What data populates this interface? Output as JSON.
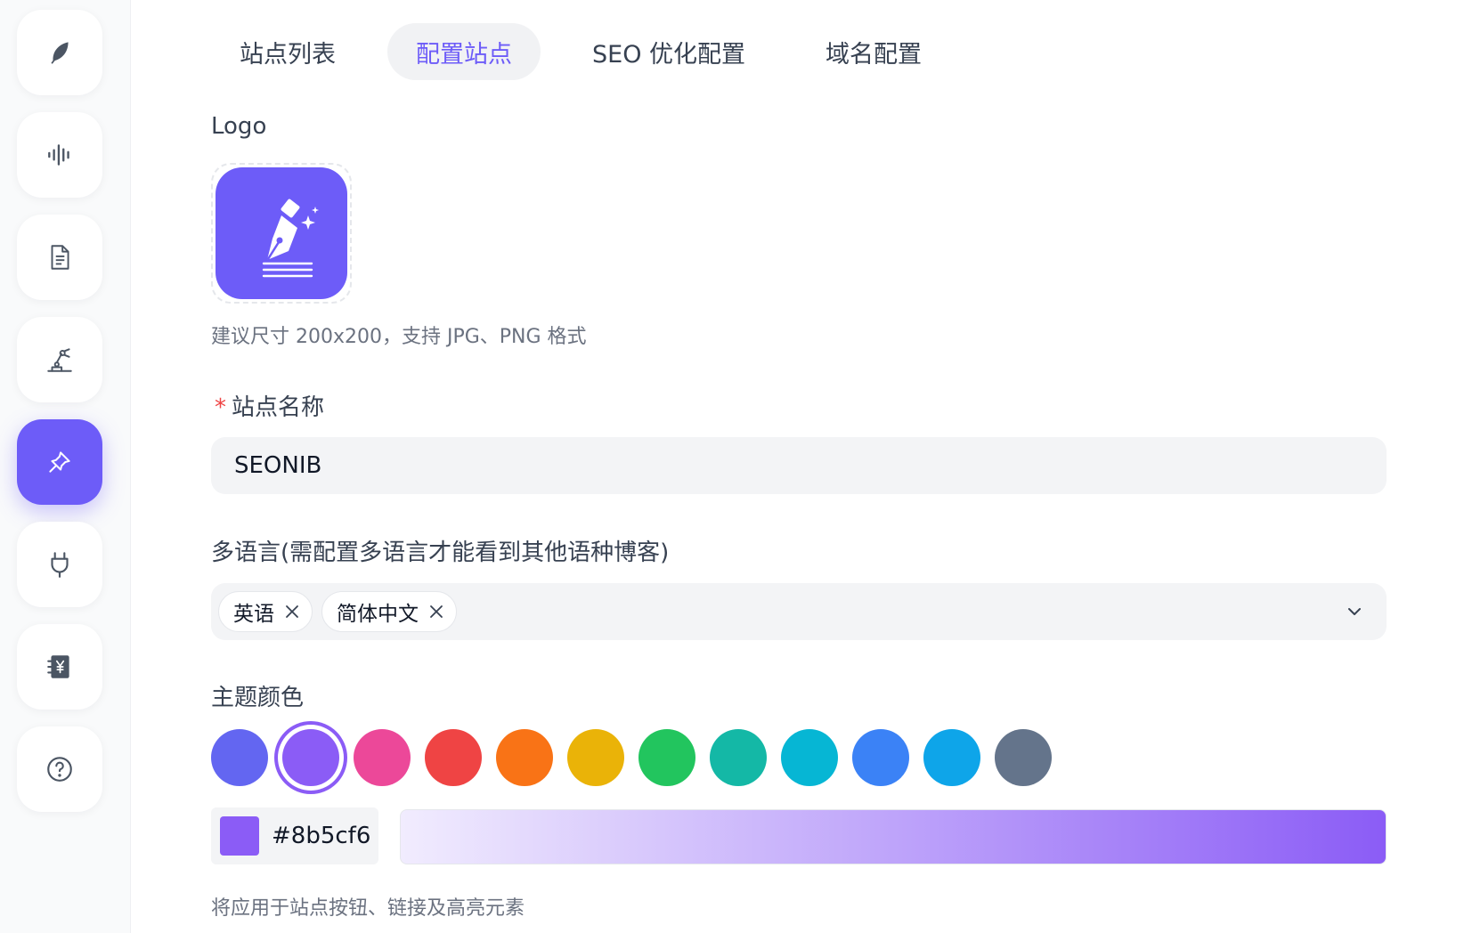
{
  "sidebar": {
    "items": [
      {
        "icon": "feather-icon",
        "active": false
      },
      {
        "icon": "audio-wave-icon",
        "active": false
      },
      {
        "icon": "document-icon",
        "active": false
      },
      {
        "icon": "robot-arm-icon",
        "active": false
      },
      {
        "icon": "pin-icon",
        "active": true
      },
      {
        "icon": "plug-icon",
        "active": false
      },
      {
        "icon": "ledger-yen-icon",
        "active": false
      },
      {
        "icon": "help-circle-icon",
        "active": false
      }
    ]
  },
  "tabs": [
    {
      "label": "站点列表",
      "active": false
    },
    {
      "label": "配置站点",
      "active": true
    },
    {
      "label": "SEO 优化配置",
      "active": false
    },
    {
      "label": "域名配置",
      "active": false
    }
  ],
  "form": {
    "logo": {
      "label": "Logo",
      "icon": "pen-nib-sparkle-icon",
      "hint": "建议尺寸 200x200，支持 JPG、PNG 格式"
    },
    "site_name": {
      "required_mark": "*",
      "label": "站点名称",
      "value": "SEONIB"
    },
    "languages": {
      "label": "多语言(需配置多语言才能看到其他语种博客)",
      "chips": [
        "英语",
        "简体中文"
      ]
    },
    "theme": {
      "label": "主题颜色",
      "swatches": [
        "#6366f1",
        "#8b5cf6",
        "#ec4899",
        "#ef4444",
        "#f97316",
        "#eab308",
        "#22c55e",
        "#14b8a6",
        "#06b6d4",
        "#3b82f6",
        "#0ea5e9",
        "#64748b"
      ],
      "selected_index": 1,
      "hex_value": "#8b5cf6",
      "hint": "将应用于站点按钮、链接及高亮元素"
    }
  },
  "colors": {
    "accent": "#6d5cf8",
    "required": "#ef4444"
  }
}
